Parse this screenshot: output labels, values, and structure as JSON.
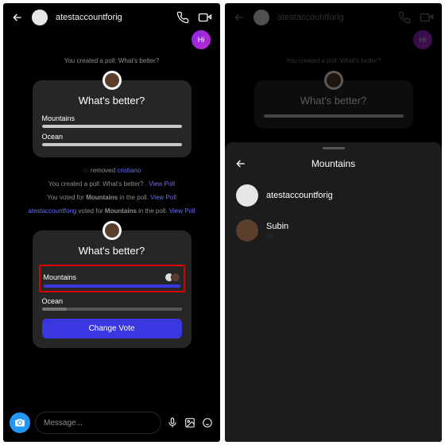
{
  "left": {
    "header": {
      "username": "atestaccountforig"
    },
    "hi_badge": "Hi",
    "sys1": "You created a poll: What's better?",
    "poll1": {
      "question": "What's better?",
      "opt1": "Mountains",
      "opt2": "Ocean"
    },
    "sys_removed_pre": "—",
    "sys_removed_mid": " removed ",
    "sys_removed_name": "cristiano",
    "sys2_a": "You created a poll: What's better? . ",
    "sys2_b": "View Poll",
    "sys3_a": "You voted for ",
    "sys3_b": "Mountains",
    "sys3_c": " in the poll. ",
    "sys3_d": "View Poll",
    "sys4_a": "atestaccountforig",
    "sys4_b": " voted for ",
    "sys4_c": "Mountains",
    "sys4_d": " in the poll. ",
    "sys4_e": "View Poll",
    "poll2": {
      "question": "What's better?",
      "opt1": "Mountains",
      "opt2": "Ocean",
      "change": "Change Vote"
    },
    "composer": {
      "placeholder": "Message..."
    }
  },
  "right": {
    "header": {
      "username": "atestaccountforig"
    },
    "hi_badge": "Hi",
    "sys1": "You created a poll: What's better?",
    "poll1": {
      "question": "What's better?"
    },
    "sheet": {
      "title": "Mountains",
      "voters": [
        {
          "name": "atestaccountforig",
          "sub": ""
        },
        {
          "name": "Subin",
          "sub": "—"
        }
      ]
    }
  }
}
